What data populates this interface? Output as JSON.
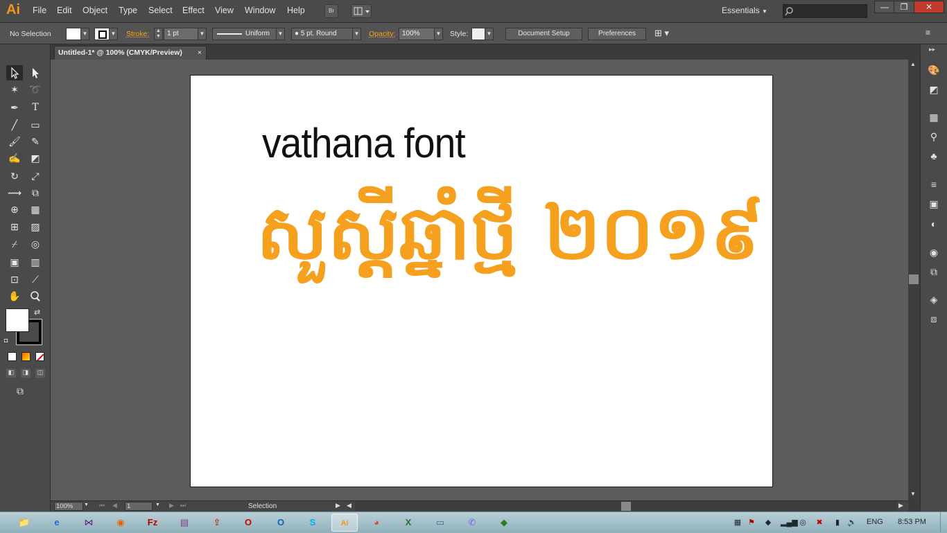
{
  "app": {
    "logo": "Ai",
    "menu": [
      "File",
      "Edit",
      "Object",
      "Type",
      "Select",
      "Effect",
      "View",
      "Window",
      "Help"
    ],
    "bridge_label": "Br",
    "workspace": "Essentials",
    "window_controls": {
      "minimize": "—",
      "restore": "❐",
      "close": "✕"
    }
  },
  "control_bar": {
    "selection_status": "No Selection",
    "stroke_label": "Stroke:",
    "stroke_weight": "1 pt",
    "profile": "Uniform",
    "brush": "5 pt. Round",
    "opacity_label": "Opacity:",
    "opacity_value": "100%",
    "style_label": "Style:",
    "document_setup": "Document Setup",
    "preferences": "Preferences"
  },
  "document": {
    "tab_title": "Untitled-1* @ 100% (CMYK/Preview)",
    "tab_close": "×",
    "artboard_text_latin": "vathana font",
    "artboard_text_khmer": "សួស្តីឆ្នាំថ្មី ២០១៩",
    "khmer_text_color": "#f6a020"
  },
  "status_bar": {
    "zoom": "100%",
    "artboard_number": "1",
    "current_tool": "Selection"
  },
  "colors": {
    "accent_orange": "#f7931e",
    "fill_color": "#ffffff",
    "stroke_color": "#000000"
  },
  "taskbar": {
    "language": "ENG",
    "time": "8:53 PM",
    "apps": [
      "explorer",
      "internet-explorer",
      "visual-studio",
      "firefox",
      "filezilla",
      "winrar",
      "file-uploader",
      "opera",
      "outlook",
      "skype",
      "illustrator",
      "chrome",
      "excel-like",
      "notepad",
      "viber",
      "network-app"
    ]
  }
}
